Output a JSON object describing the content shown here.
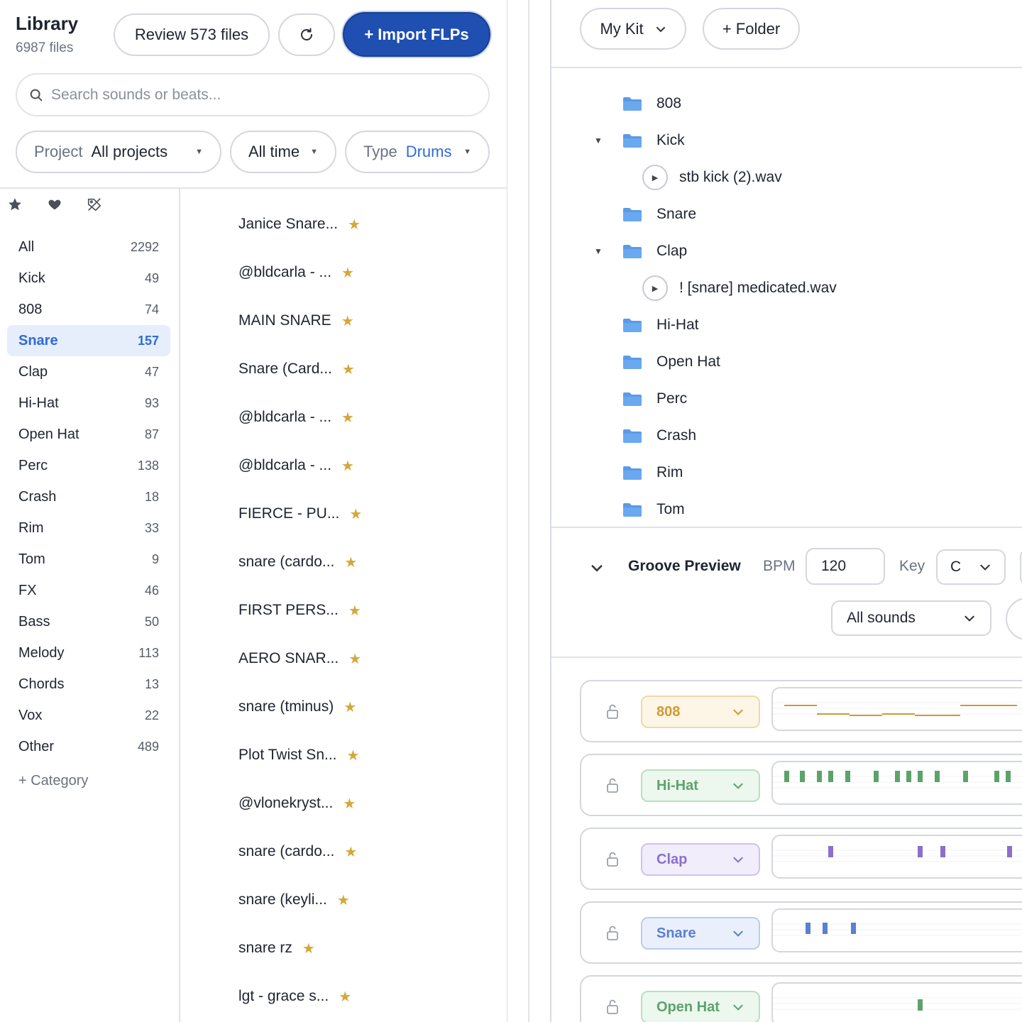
{
  "library": {
    "title": "Library",
    "file_count": "6987 files",
    "review_label": "Review 573 files",
    "import_label": "+ Import FLPs",
    "search_placeholder": "Search sounds or beats...",
    "filters": {
      "project_label": "Project",
      "project_value": "All projects",
      "time_value": "All time",
      "type_label": "Type",
      "type_value": "Drums"
    },
    "icons": [
      "star-icon",
      "heart-icon",
      "tag-off-icon"
    ]
  },
  "categories": [
    {
      "name": "All",
      "count": "2292"
    },
    {
      "name": "Kick",
      "count": "49"
    },
    {
      "name": "808",
      "count": "74"
    },
    {
      "name": "Snare",
      "count": "157",
      "active": true
    },
    {
      "name": "Clap",
      "count": "47"
    },
    {
      "name": "Hi-Hat",
      "count": "93"
    },
    {
      "name": "Open Hat",
      "count": "87"
    },
    {
      "name": "Perc",
      "count": "138"
    },
    {
      "name": "Crash",
      "count": "18"
    },
    {
      "name": "Rim",
      "count": "33"
    },
    {
      "name": "Tom",
      "count": "9"
    },
    {
      "name": "FX",
      "count": "46"
    },
    {
      "name": "Bass",
      "count": "50"
    },
    {
      "name": "Melody",
      "count": "113"
    },
    {
      "name": "Chords",
      "count": "13"
    },
    {
      "name": "Vox",
      "count": "22"
    },
    {
      "name": "Other",
      "count": "489"
    }
  ],
  "add_category_label": "+ Category",
  "files": [
    "Janice Snare...",
    "@bldcarla - ...",
    "MAIN SNARE",
    "Snare (Card...",
    "@bldcarla - ...",
    "@bldcarla - ...",
    "FIERCE - PU...",
    "snare (cardo...",
    "FIRST PERS...",
    "AERO SNAR...",
    "snare (tminus)",
    "Plot Twist Sn...",
    "@vlonekryst...",
    "snare (cardo...",
    "snare (keyli...",
    "snare rz",
    "lgt - grace s..."
  ],
  "kit": {
    "mykit_label": "My Kit",
    "folder_label": "+ Folder",
    "tree": [
      {
        "type": "folder",
        "label": "808"
      },
      {
        "type": "folder",
        "label": "Kick",
        "expanded": true
      },
      {
        "type": "file",
        "label": "stb kick (2).wav"
      },
      {
        "type": "folder",
        "label": "Snare"
      },
      {
        "type": "folder",
        "label": "Clap",
        "expanded": true
      },
      {
        "type": "file",
        "label": "! [snare] medicated.wav"
      },
      {
        "type": "folder",
        "label": "Hi-Hat"
      },
      {
        "type": "folder",
        "label": "Open Hat"
      },
      {
        "type": "folder",
        "label": "Perc"
      },
      {
        "type": "folder",
        "label": "Crash"
      },
      {
        "type": "folder",
        "label": "Rim"
      },
      {
        "type": "folder",
        "label": "Tom"
      }
    ]
  },
  "groove": {
    "title": "Groove Preview",
    "bpm_label": "BPM",
    "bpm_value": "120",
    "key_label": "Key",
    "key_value": "C",
    "sounds_value": "All sounds"
  },
  "tracks": [
    {
      "label": "808",
      "bg": "#fdf5e6",
      "border": "#f0d9a8",
      "color": "#d19a33",
      "pattern": "808"
    },
    {
      "label": "Hi-Hat",
      "bg": "#ecf7ee",
      "border": "#b9dfc1",
      "color": "#5ca36a",
      "pattern": "hihat"
    },
    {
      "label": "Clap",
      "bg": "#f1edfb",
      "border": "#cfc3ee",
      "color": "#8a70cc",
      "pattern": "clap"
    },
    {
      "label": "Snare",
      "bg": "#eaf0fb",
      "border": "#bccbee",
      "color": "#5b7fd1",
      "pattern": "snare"
    },
    {
      "label": "Open Hat",
      "bg": "#ecf7ee",
      "border": "#b9dfc1",
      "color": "#5ca36a",
      "pattern": "openhat"
    }
  ],
  "colors": {
    "accent": "#1f4fb0",
    "active_blue": "#2e6bd6",
    "star": "#d4a73a",
    "folder": "#5b9ae6"
  }
}
